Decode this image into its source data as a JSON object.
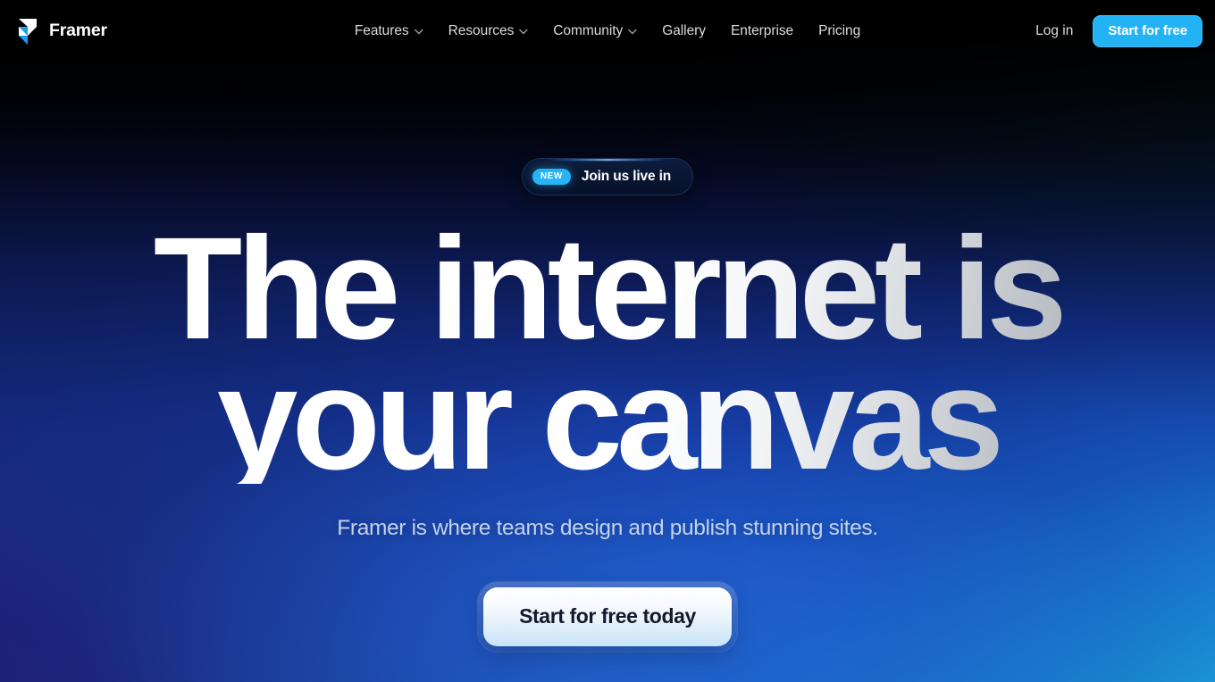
{
  "header": {
    "brand": {
      "name": "Framer",
      "logo_icon": "framer-logo-icon"
    },
    "nav": [
      {
        "label": "Features",
        "has_dropdown": true,
        "icon": "chevron-down-icon"
      },
      {
        "label": "Resources",
        "has_dropdown": true,
        "icon": "chevron-down-icon"
      },
      {
        "label": "Community",
        "has_dropdown": true,
        "icon": "chevron-down-icon"
      },
      {
        "label": "Gallery",
        "has_dropdown": false,
        "icon": ""
      },
      {
        "label": "Enterprise",
        "has_dropdown": false,
        "icon": ""
      },
      {
        "label": "Pricing",
        "has_dropdown": false,
        "icon": ""
      }
    ],
    "login_label": "Log in",
    "cta_label": "Start for free"
  },
  "hero": {
    "announcement": {
      "badge": "NEW",
      "text": "Join us live in"
    },
    "headline_line1": "The internet is",
    "headline_line2": "your canvas",
    "subtitle": "Framer is where teams design and publish stunning sites.",
    "cta_label": "Start for free today"
  },
  "colors": {
    "accent_cyan": "#23b3f5",
    "badge_cyan": "#27b4f6",
    "text_primary": "#ffffff",
    "text_nav": "#d9dadd",
    "text_subtitle": "#c3d2ec",
    "cta_text_dark": "#121a2c",
    "bg_top": "#000000",
    "bg_bottom_left": "#1d0f5e",
    "bg_bottom_right": "#1cb2e4",
    "bg_center": "#1e4cb8"
  }
}
